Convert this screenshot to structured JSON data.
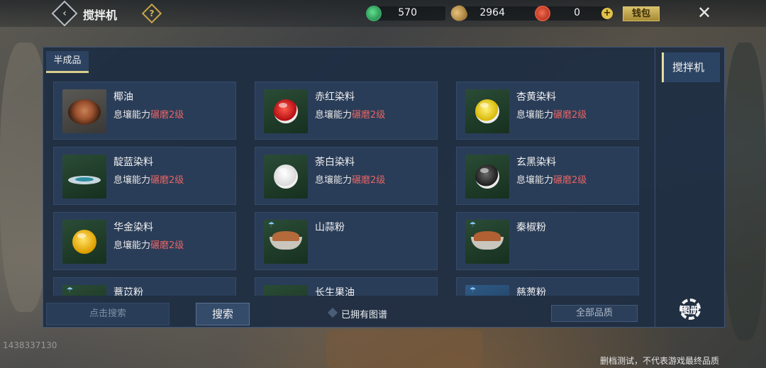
{
  "header": {
    "title": "搅拌机",
    "back_icon": "‹",
    "help_icon": "?",
    "currencies": [
      {
        "icon": "jade-token-icon",
        "value": "570"
      },
      {
        "icon": "bean-icon",
        "value": "2964"
      },
      {
        "icon": "red-coin-icon",
        "value": "0"
      }
    ],
    "add_icon": "+",
    "wallet_label": "钱包",
    "close_icon": "✕"
  },
  "panel": {
    "tab_label": "半成品",
    "side_tab_label": "搅拌机",
    "items": [
      {
        "name": "椰油",
        "req_text": "息壤能力",
        "req_level": "碾磨2级",
        "art": "coconut"
      },
      {
        "name": "赤红染料",
        "req_text": "息壤能力",
        "req_level": "碾磨2级",
        "art": "orb-red"
      },
      {
        "name": "杏黄染料",
        "req_text": "息壤能力",
        "req_level": "碾磨2级",
        "art": "orb-yellow"
      },
      {
        "name": "靛蓝染料",
        "req_text": "息壤能力",
        "req_level": "碾磨2级",
        "art": "dish"
      },
      {
        "name": "荼白染料",
        "req_text": "息壤能力",
        "req_level": "碾磨2级",
        "art": "orb-white"
      },
      {
        "name": "玄黑染料",
        "req_text": "息壤能力",
        "req_level": "碾磨2级",
        "art": "orb-black"
      },
      {
        "name": "华金染料",
        "req_text": "息壤能力",
        "req_level": "碾磨2级",
        "art": "orb-gold"
      },
      {
        "name": "山蒜粉",
        "req_text": "",
        "req_level": "",
        "art": "powder"
      },
      {
        "name": "秦椒粉",
        "req_text": "",
        "req_level": "",
        "art": "powder"
      },
      {
        "name": "薏苡粉",
        "req_text": "",
        "req_level": "",
        "art": "partial-green"
      },
      {
        "name": "长生果油",
        "req_text": "",
        "req_level": "",
        "art": "partial-green"
      },
      {
        "name": "慈葱粉",
        "req_text": "",
        "req_level": "",
        "art": "partial-blue"
      }
    ]
  },
  "footer": {
    "search_placeholder": "点击搜索",
    "search_button": "搜索",
    "owned_label": "已拥有图谱",
    "quality_select": "全部品质",
    "gear_label": "图册"
  },
  "watermark_uid": "1438337130",
  "disclaimer": "删档测试，不代表游戏最终品质"
}
